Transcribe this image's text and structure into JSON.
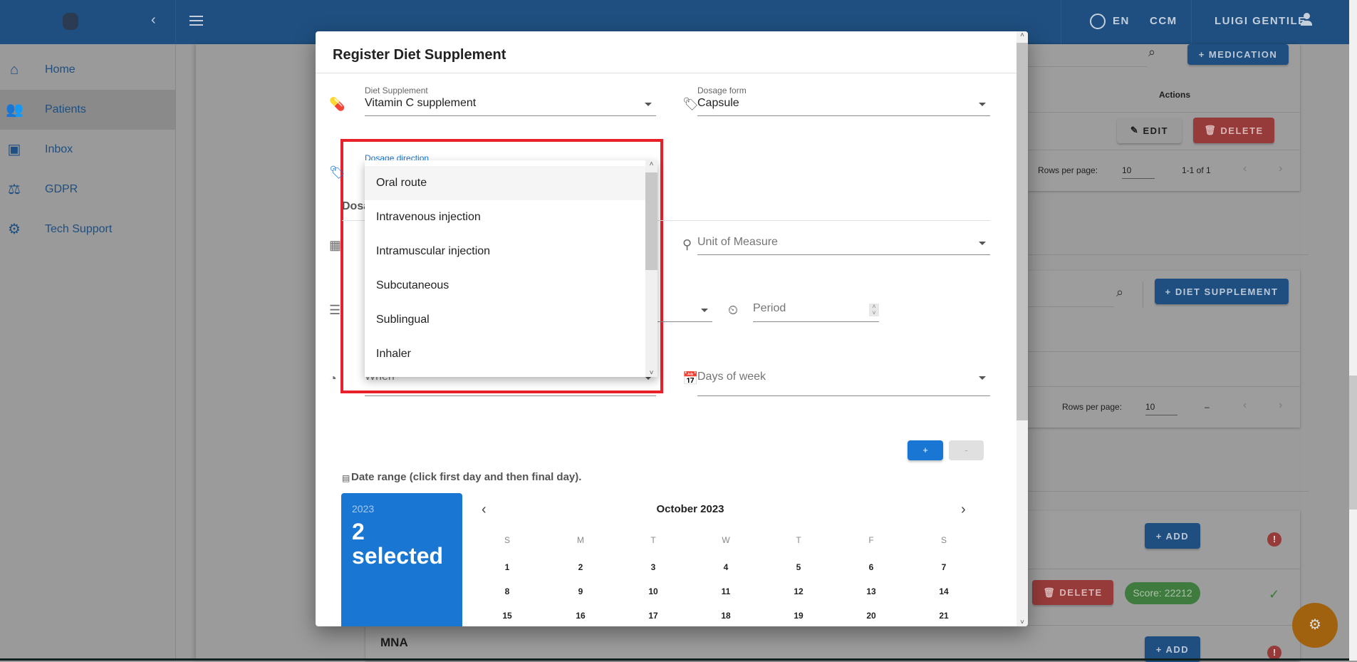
{
  "header": {
    "language": "EN",
    "org": "CCM",
    "user": "LUIGI GENTILE"
  },
  "sidebar": {
    "items": [
      {
        "label": "Home",
        "icon": "home-icon"
      },
      {
        "label": "Patients",
        "icon": "people-icon",
        "selected": true
      },
      {
        "label": "Inbox",
        "icon": "inbox-icon"
      },
      {
        "label": "GDPR",
        "icon": "gavel-icon"
      },
      {
        "label": "Tech Support",
        "icon": "support-icon"
      }
    ]
  },
  "background": {
    "medication": {
      "add_label": "+ MEDICATION",
      "actions_header": "Actions",
      "edit_label": "EDIT",
      "delete_label": "DELETE",
      "rows_per_page_label": "Rows per page:",
      "rows_per_page": "10",
      "range": "1-1 of 1"
    },
    "supplement": {
      "add_label": "+ DIET SUPPLEMENT",
      "rows_per_page_label": "Rows per page:",
      "rows_per_page": "10",
      "range": "–"
    },
    "assessments": {
      "add_label": "+ ADD",
      "delete_label": "DELETE",
      "score": "Score: 22212",
      "add_label2": "+ ADD",
      "mna_title": "MNA"
    },
    "colors": {
      "header": "#1f4f80",
      "primary": "#1976d2",
      "danger": "#d32f2f",
      "success": "#2e7d32",
      "fab": "#e8961a"
    }
  },
  "modal": {
    "title": "Register Diet Supplement",
    "diet_supplement": {
      "label": "Diet Supplement",
      "value": "Vitamin C supplement"
    },
    "dosage_form": {
      "label": "Dosage form",
      "value": "Capsule"
    },
    "dosage_direction": {
      "label": "Dosage direction",
      "options": [
        "Oral route",
        "Intravenous injection",
        "Intramuscular injection",
        "Subcutaneous",
        "Sublingual",
        "Inhaler"
      ],
      "highlighted": "Oral route"
    },
    "dosage_section_partial": "Dosa",
    "unit_of_measure": {
      "placeholder": "Unit of Measure"
    },
    "period": {
      "placeholder": "Period"
    },
    "when": {
      "placeholder": "When"
    },
    "days_of_week": {
      "placeholder": "Days of week"
    },
    "plus_label": "+",
    "minus_label": "-",
    "date_range_label": "Date range (click first day and then final day).",
    "calendar": {
      "year": "2023",
      "selected_count": "2",
      "selected_word": "selected",
      "month": "October 2023",
      "weekdays": [
        "S",
        "M",
        "T",
        "W",
        "T",
        "F",
        "S"
      ],
      "days": [
        [
          "1",
          "2",
          "3",
          "4",
          "5",
          "6",
          "7"
        ],
        [
          "8",
          "9",
          "10",
          "11",
          "12",
          "13",
          "14"
        ],
        [
          "15",
          "16",
          "17",
          "18",
          "19",
          "20",
          "21"
        ]
      ]
    }
  }
}
